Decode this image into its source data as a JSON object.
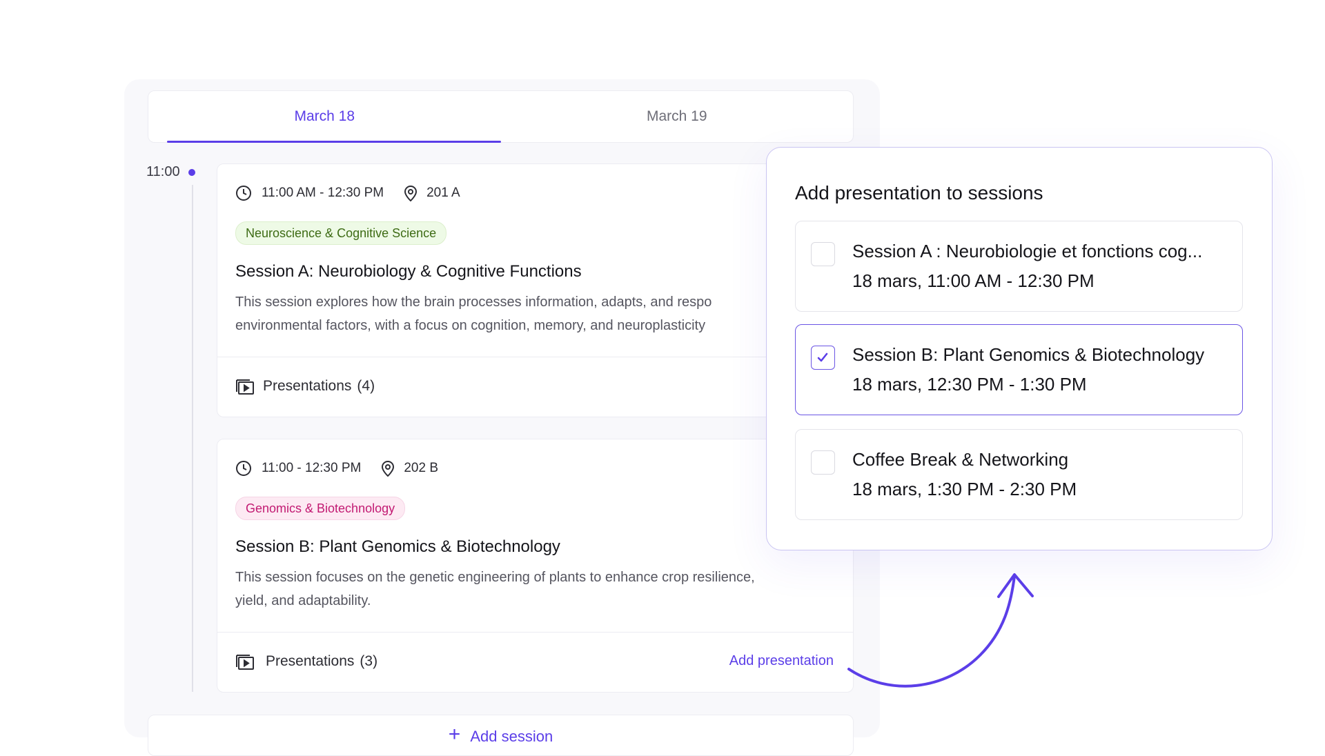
{
  "tabs": [
    {
      "label": "March 18",
      "active": true
    },
    {
      "label": "March 19",
      "active": false
    }
  ],
  "timeline": {
    "time": "11:00"
  },
  "sessions": [
    {
      "time": "11:00 AM - 12:30 PM",
      "room": "201 A",
      "tag": "Neuroscience & Cognitive Science",
      "title": "Session A: Neurobiology & Cognitive Functions",
      "desc_line1": "This session explores how the brain processes information, adapts, and respo",
      "desc_line2": "environmental factors, with a focus on cognition, memory, and neuroplasticity",
      "presentations_label": "Presentations",
      "presentations_count": "(4)"
    },
    {
      "time": "11:00 - 12:30 PM",
      "room": "202 B",
      "tag": "Genomics & Biotechnology",
      "title": "Session B: Plant Genomics & Biotechnology",
      "desc_line1": "This session focuses on the genetic engineering of plants to enhance crop resilience,",
      "desc_line2": "yield, and adaptability.",
      "presentations_label": "Presentations",
      "presentations_count": "(3)",
      "add_presentation": "Add presentation"
    }
  ],
  "add_session": {
    "plus": "+",
    "label": "Add session"
  },
  "popup": {
    "title": "Add presentation to sessions",
    "options": [
      {
        "title": "Session A : Neurobiologie et fonctions cog...",
        "time": "18 mars, 11:00 AM - 12:30 PM",
        "checked": false
      },
      {
        "title": "Session B: Plant Genomics & Biotechnology",
        "time": "18 mars, 12:30 PM - 1:30 PM",
        "checked": true
      },
      {
        "title": "Coffee Break & Networking",
        "time": "18 mars, 1:30 PM - 2:30 PM",
        "checked": false
      }
    ]
  },
  "colors": {
    "accent": "#5b3ee8",
    "tag_green": "#3d6b14",
    "tag_pink": "#c21a72"
  }
}
